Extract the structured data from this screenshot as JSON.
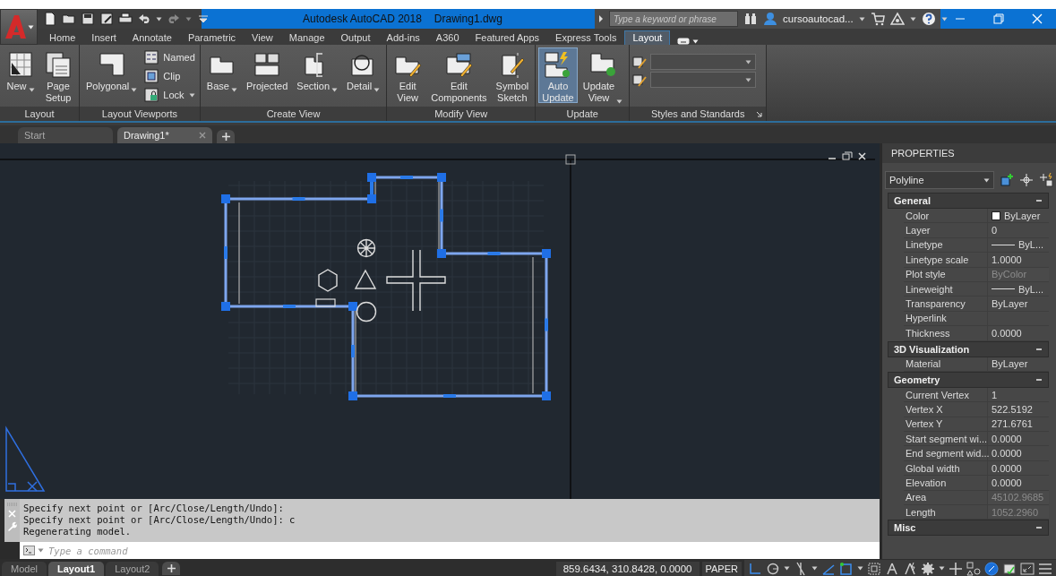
{
  "title_bar": {
    "app_title": "Autodesk AutoCAD 2018",
    "file_name": "Drawing1.dwg",
    "search_placeholder": "Type a keyword or phrase",
    "user_name": "cursoautocad..."
  },
  "ribbon_tabs": [
    {
      "label": "Home",
      "selected": false
    },
    {
      "label": "Insert",
      "selected": false
    },
    {
      "label": "Annotate",
      "selected": false
    },
    {
      "label": "Parametric",
      "selected": false
    },
    {
      "label": "View",
      "selected": false
    },
    {
      "label": "Manage",
      "selected": false
    },
    {
      "label": "Output",
      "selected": false
    },
    {
      "label": "Add-ins",
      "selected": false
    },
    {
      "label": "A360",
      "selected": false
    },
    {
      "label": "Featured Apps",
      "selected": false
    },
    {
      "label": "Express Tools",
      "selected": false
    },
    {
      "label": "Layout",
      "selected": true
    }
  ],
  "ribbon_panels": [
    {
      "title": "Layout",
      "launcher": false,
      "tools": [
        {
          "kind": "large",
          "label": "New",
          "dropdown": true,
          "selected": false
        },
        {
          "kind": "large",
          "label": "Page Setup",
          "dropdown": false,
          "selected": false
        }
      ]
    },
    {
      "title": "Layout Viewports",
      "launcher": false,
      "tools": [
        {
          "kind": "large",
          "label": "Polygonal",
          "dropdown": true,
          "selected": false
        },
        {
          "kind": "stack",
          "items": [
            {
              "label": "Named",
              "dropdown": false
            },
            {
              "label": "Clip",
              "dropdown": false
            },
            {
              "label": "Lock",
              "dropdown": true
            }
          ]
        }
      ]
    },
    {
      "title": "Create View",
      "launcher": false,
      "tools": [
        {
          "kind": "large",
          "label": "Base",
          "dropdown": true,
          "selected": false
        },
        {
          "kind": "large",
          "label": "Projected",
          "dropdown": false,
          "selected": false
        },
        {
          "kind": "large",
          "label": "Section",
          "dropdown": true,
          "selected": false
        },
        {
          "kind": "large",
          "label": "Detail",
          "dropdown": true,
          "selected": false
        }
      ]
    },
    {
      "title": "Modify View",
      "launcher": false,
      "tools": [
        {
          "kind": "large",
          "label": "Edit View",
          "dropdown": false,
          "selected": false
        },
        {
          "kind": "large",
          "label": "Edit Components",
          "dropdown": false,
          "selected": false
        },
        {
          "kind": "large",
          "label": "Symbol Sketch",
          "dropdown": false,
          "selected": false
        }
      ]
    },
    {
      "title": "Update",
      "launcher": false,
      "tools": [
        {
          "kind": "large",
          "label": "Auto Update",
          "dropdown": false,
          "selected": true
        },
        {
          "kind": "large",
          "label": "Update View",
          "dropdown": true,
          "selected": false
        }
      ]
    },
    {
      "title": "Styles and Standards",
      "launcher": true,
      "tools": [
        {
          "kind": "combo"
        },
        {
          "kind": "combo"
        }
      ]
    }
  ],
  "document_tabs": [
    {
      "label": "Start",
      "selected": false,
      "closable": false
    },
    {
      "label": "Drawing1*",
      "selected": true,
      "closable": true
    }
  ],
  "command_line": {
    "history": [
      "Specify next point or [Arc/Close/Length/Undo]:",
      "Specify next point or [Arc/Close/Length/Undo]: c",
      "Regenerating model."
    ],
    "placeholder": "Type a command"
  },
  "properties": {
    "title": "PROPERTIES",
    "object_type": "Polyline",
    "sections": [
      {
        "title": "General",
        "expanded": true,
        "rows": [
          {
            "label": "Color",
            "value": "ByLayer",
            "kind": "color",
            "disabled": false
          },
          {
            "label": "Layer",
            "value": "0",
            "kind": "text",
            "disabled": false
          },
          {
            "label": "Linetype",
            "value": "ByL...",
            "kind": "line",
            "disabled": false
          },
          {
            "label": "Linetype scale",
            "value": "1.0000",
            "kind": "text",
            "disabled": false
          },
          {
            "label": "Plot style",
            "value": "ByColor",
            "kind": "text",
            "disabled": true
          },
          {
            "label": "Lineweight",
            "value": "ByL...",
            "kind": "line",
            "disabled": false
          },
          {
            "label": "Transparency",
            "value": "ByLayer",
            "kind": "text",
            "disabled": false
          },
          {
            "label": "Hyperlink",
            "value": "",
            "kind": "text",
            "disabled": false
          },
          {
            "label": "Thickness",
            "value": "0.0000",
            "kind": "text",
            "disabled": false
          }
        ]
      },
      {
        "title": "3D Visualization",
        "expanded": true,
        "rows": [
          {
            "label": "Material",
            "value": "ByLayer",
            "kind": "text",
            "disabled": false
          }
        ]
      },
      {
        "title": "Geometry",
        "expanded": true,
        "rows": [
          {
            "label": "Current Vertex",
            "value": "1",
            "kind": "text",
            "disabled": false
          },
          {
            "label": "Vertex X",
            "value": "522.5192",
            "kind": "text",
            "disabled": false
          },
          {
            "label": "Vertex Y",
            "value": "271.6761",
            "kind": "text",
            "disabled": false
          },
          {
            "label": "Start segment wi...",
            "value": "0.0000",
            "kind": "text",
            "disabled": false
          },
          {
            "label": "End segment wid...",
            "value": "0.0000",
            "kind": "text",
            "disabled": false
          },
          {
            "label": "Global width",
            "value": "0.0000",
            "kind": "text",
            "disabled": false
          },
          {
            "label": "Elevation",
            "value": "0.0000",
            "kind": "text",
            "disabled": false
          },
          {
            "label": "Area",
            "value": "45102.9685",
            "kind": "text",
            "disabled": true
          },
          {
            "label": "Length",
            "value": "1052.2960",
            "kind": "text",
            "disabled": true
          }
        ]
      },
      {
        "title": "Misc",
        "expanded": true
      }
    ]
  },
  "layout_tabs": [
    {
      "label": "Model",
      "selected": false
    },
    {
      "label": "Layout1",
      "selected": true
    },
    {
      "label": "Layout2",
      "selected": false
    }
  ],
  "status_bar": {
    "coordinates": "859.6434, 310.8428, 0.0000",
    "space": "PAPER"
  }
}
